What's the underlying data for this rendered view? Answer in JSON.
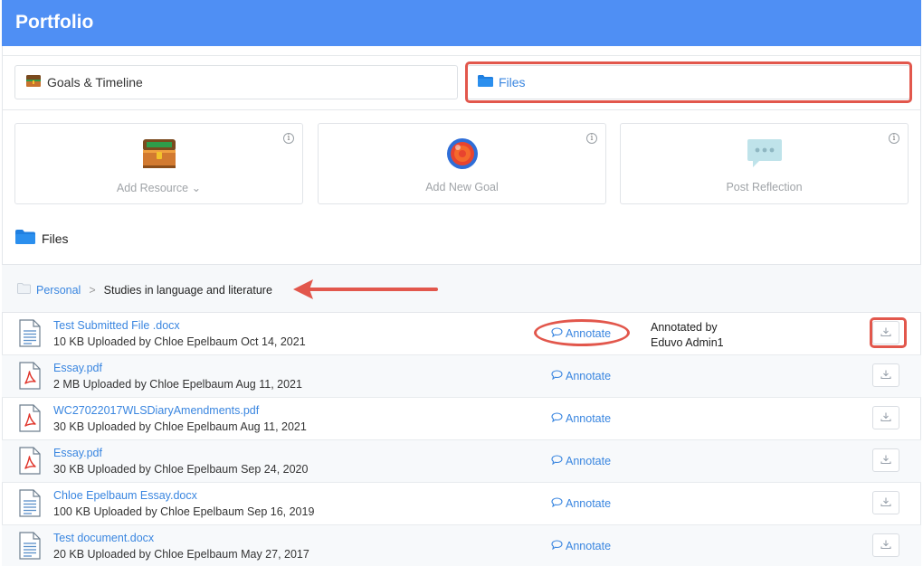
{
  "header": {
    "title": "Portfolio"
  },
  "tabs": [
    {
      "label": "Goals & Timeline",
      "icon": "treasure-chest-icon"
    },
    {
      "label": "Files",
      "icon": "folder-icon",
      "active": true
    }
  ],
  "cards": [
    {
      "label": "Add Resource",
      "dropdown_indicator": "⌄",
      "icon": "treasure-chest-icon",
      "info": "i"
    },
    {
      "label": "Add New Goal",
      "icon": "target-icon",
      "info": "i"
    },
    {
      "label": "Post Reflection",
      "icon": "speech-bubble-icon",
      "info": "i"
    }
  ],
  "files_section": {
    "heading": "Files",
    "icon": "folder-icon"
  },
  "breadcrumb": {
    "root": "Personal",
    "separator": ">",
    "current": "Studies in language and literature"
  },
  "annotate_label": "Annotate",
  "files": [
    {
      "name": "Test Submitted File .docx",
      "meta": "10 KB Uploaded by Chloe Epelbaum Oct 14, 2021",
      "type": "docx",
      "annotated_by_label": "Annotated by",
      "annotated_by_name": "Eduvo Admin1"
    },
    {
      "name": "Essay.pdf",
      "meta": "2 MB Uploaded by Chloe Epelbaum Aug 11, 2021",
      "type": "pdf"
    },
    {
      "name": "WC27022017WLSDiaryAmendments.pdf",
      "meta": "30 KB Uploaded by Chloe Epelbaum Aug 11, 2021",
      "type": "pdf"
    },
    {
      "name": "Essay.pdf",
      "meta": "30 KB Uploaded by Chloe Epelbaum Sep 24, 2020",
      "type": "pdf"
    },
    {
      "name": "Chloe Epelbaum Essay.docx",
      "meta": "100 KB Uploaded by Chloe Epelbaum Sep 16, 2019",
      "type": "docx"
    },
    {
      "name": "Test document.docx",
      "meta": "20 KB Uploaded by Chloe Epelbaum May 27, 2017",
      "type": "docx"
    }
  ],
  "colors": {
    "header": "#4f8ff4",
    "link": "#3a86e0",
    "highlight": "#e2574c"
  }
}
